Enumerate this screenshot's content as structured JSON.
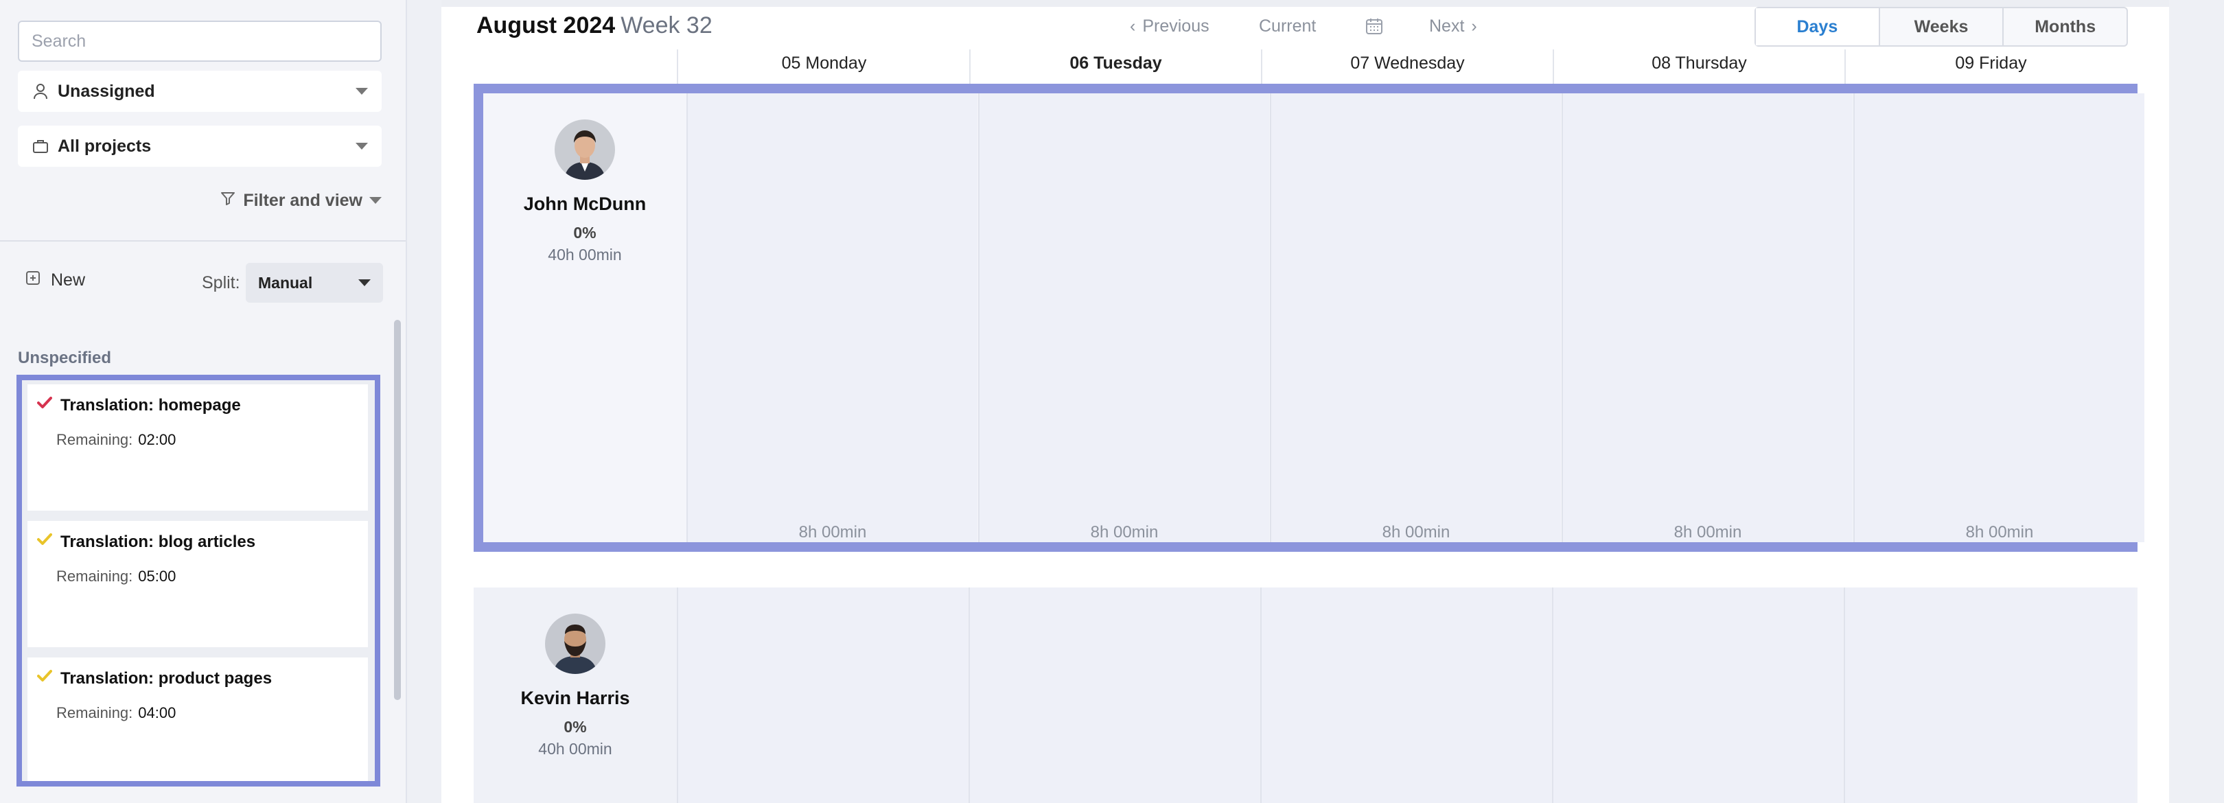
{
  "sidebar": {
    "search_placeholder": "Search",
    "assignee_dropdown": "Unassigned",
    "projects_dropdown": "All projects",
    "filter_label": "Filter and view",
    "new_label": "New",
    "split_label": "Split:",
    "split_value": "Manual",
    "group_label": "Unspecified",
    "tasks": [
      {
        "title": "Translation: homepage",
        "remaining_label": "Remaining:",
        "remaining": "02:00",
        "check_color": "#d6334f"
      },
      {
        "title": "Translation: blog articles",
        "remaining_label": "Remaining:",
        "remaining": "05:00",
        "check_color": "#e9c42a"
      },
      {
        "title": "Translation: product pages",
        "remaining_label": "Remaining:",
        "remaining": "04:00",
        "check_color": "#e9c42a"
      }
    ]
  },
  "header": {
    "month": "August 2024",
    "week": "Week 32",
    "prev_label": "Previous",
    "current_label": "Current",
    "next_label": "Next",
    "views": [
      "Days",
      "Weeks",
      "Months"
    ],
    "active_view": "Days"
  },
  "days": [
    "05 Monday",
    "06 Tuesday",
    "07 Wednesday",
    "08 Thursday",
    "09 Friday"
  ],
  "today": "06 Tuesday",
  "people": [
    {
      "name": "John McDunn",
      "utilization": "0%",
      "capacity": "40h 00min",
      "daily_hours": [
        "8h 00min",
        "8h 00min",
        "8h 00min",
        "8h 00min",
        "8h 00min"
      ]
    },
    {
      "name": "Kevin Harris",
      "utilization": "0%",
      "capacity": "40h 00min",
      "daily_hours": []
    }
  ],
  "colors": {
    "accent": "#2a7fd0",
    "highlight": "#8c95dc"
  }
}
